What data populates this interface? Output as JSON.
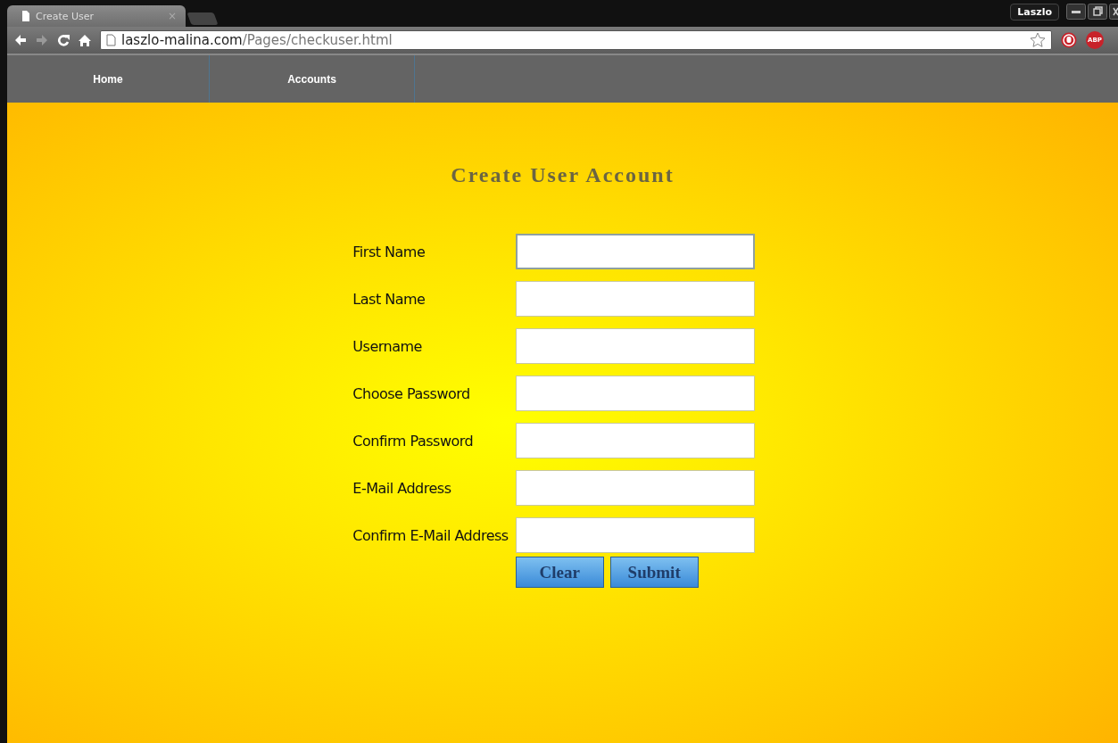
{
  "browser": {
    "tabs": [
      {
        "title": "Create User",
        "close": "×",
        "selected": true
      }
    ],
    "profile": "Laszlo",
    "url": {
      "host": "laszlo-malina.com",
      "path": "/Pages/checkuser.html"
    },
    "extensions": [
      {
        "kind": "stop"
      },
      {
        "kind": "abp",
        "label": "ABP"
      }
    ]
  },
  "nav": [
    {
      "label": "Home"
    },
    {
      "label": "Accounts"
    }
  ],
  "form": {
    "title": "Create User Account",
    "fields": [
      {
        "label": "First Name",
        "focused": true
      },
      {
        "label": "Last Name",
        "focused": false
      },
      {
        "label": "Username",
        "focused": false
      },
      {
        "label": "Choose Password",
        "focused": false
      },
      {
        "label": "Confirm Password",
        "focused": false
      },
      {
        "label": "E-Mail Address",
        "focused": false
      },
      {
        "label": "Confirm E-Mail Address",
        "focused": false
      }
    ],
    "buttons": [
      "Clear",
      "Submit"
    ]
  }
}
